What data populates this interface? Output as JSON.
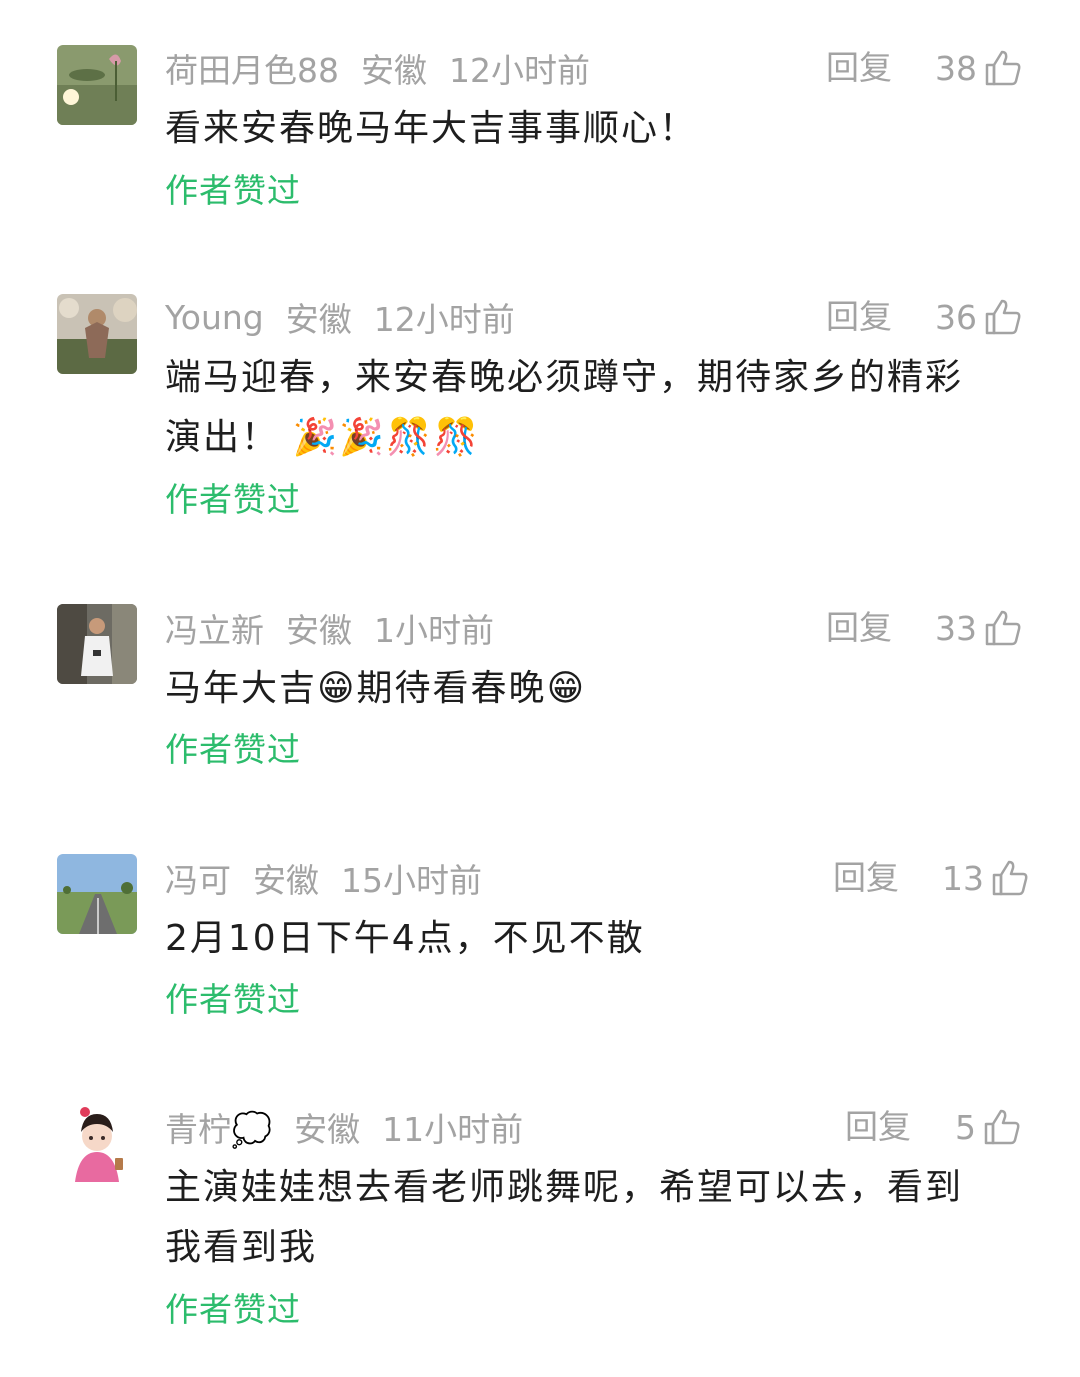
{
  "comments": [
    {
      "username": "荷田月色88",
      "location": "安徽",
      "time": "12小时前",
      "reply_label": "回复",
      "likes": "38",
      "text": "看来安春晚马年大吉事事顺心！",
      "liked_by_author": "作者赞过"
    },
    {
      "username": "Young",
      "location": "安徽",
      "time": "12小时前",
      "reply_label": "回复",
      "likes": "36",
      "text_line1": "端马迎春，来安春晚必须蹲守，期待家乡的精彩",
      "text_line2": "演出！",
      "emojis": "🎉🎉🎊🎊",
      "liked_by_author": "作者赞过"
    },
    {
      "username": "冯立新",
      "location": "安徽",
      "time": "1小时前",
      "reply_label": "回复",
      "likes": "33",
      "text_part1": "马年大吉",
      "emoji1": "😁",
      "text_part2": "期待看春晚",
      "emoji2": "😁",
      "liked_by_author": "作者赞过"
    },
    {
      "username": "冯可",
      "location": "安徽",
      "time": "15小时前",
      "reply_label": "回复",
      "likes": "13",
      "text": "2月10日下午4点，不见不散",
      "liked_by_author": "作者赞过"
    },
    {
      "username": "青柠💭",
      "location": "安徽",
      "time": "11小时前",
      "reply_label": "回复",
      "likes": "5",
      "text_line1": "主演娃娃想去看老师跳舞呢，希望可以去，看到",
      "text_line2": "我看到我",
      "liked_by_author": "作者赞过"
    }
  ],
  "colors": {
    "meta_gray": "#a3a3a3",
    "text_dark": "#1e1e1e",
    "liked_green": "#2cbc6c"
  }
}
